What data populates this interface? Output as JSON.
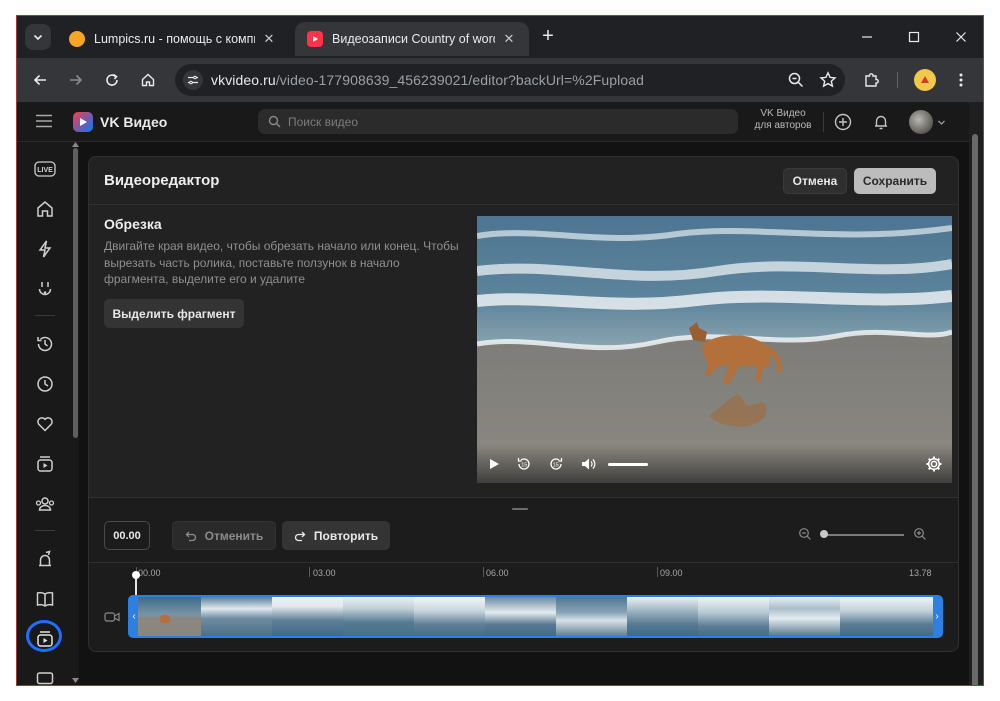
{
  "browser": {
    "tabs": [
      {
        "title": "Lumpics.ru - помощь с компьютером",
        "favicon_color": "#f5a623",
        "active": false
      },
      {
        "title": "Видеозаписи Country of words",
        "favicon_color": "#ff3347",
        "active": true
      }
    ],
    "url_host": "vkvideo.ru",
    "url_path": "/video-177908639_456239021/editor?backUrl=%2Fupload"
  },
  "vk": {
    "logo_text": "VK Видео",
    "search_placeholder": "Поиск видео",
    "for_authors": "VK Видео для авторов"
  },
  "editor": {
    "title": "Видеоредактор",
    "cancel_label": "Отмена",
    "save_label": "Сохранить",
    "trim_title": "Обрезка",
    "trim_description": "Двигайте края видео, чтобы обрезать начало или конец. Чтобы вырезать часть ролика, поставьте ползунок в начало фрагмента, выделите его и удалите",
    "select_fragment_label": "Выделить фрагмент",
    "current_time": "00.00",
    "undo_label": "Отменить",
    "redo_label": "Повторить",
    "ruler_labels": [
      "00.00",
      "03.00",
      "06.00",
      "09.00",
      "13.78"
    ]
  },
  "sidebar": {
    "items": [
      "live-icon",
      "home-icon",
      "lightning-icon",
      "shorts-icon",
      "history-icon",
      "watch-later-icon",
      "heart-icon",
      "subscriptions-icon",
      "community-icon",
      "upload-icon",
      "book-icon",
      "my-videos-icon",
      "tv-icon"
    ]
  },
  "colors": {
    "accent": "#2d7fe0",
    "highlight_ring": "#1e6fff"
  }
}
